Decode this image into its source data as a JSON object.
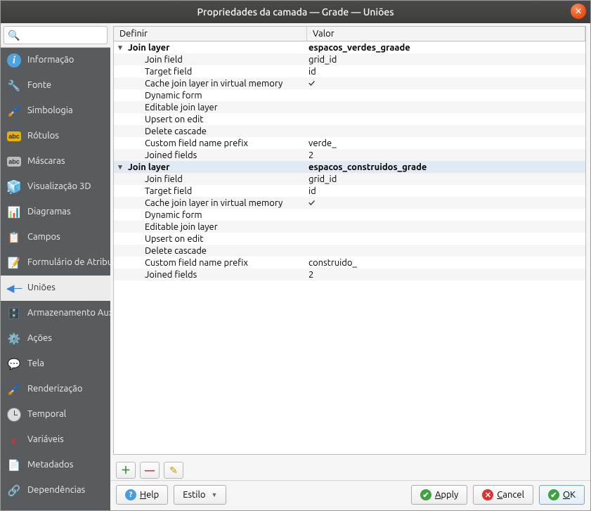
{
  "title": "Propriedades da camada — Grade — Uniões",
  "search_placeholder": "",
  "sidebar": {
    "items": [
      {
        "label": "Informação",
        "icon": "info"
      },
      {
        "label": "Fonte",
        "icon": "wrench"
      },
      {
        "label": "Simbologia",
        "icon": "brush"
      },
      {
        "label": "Rótulos",
        "icon": "abc"
      },
      {
        "label": "Máscaras",
        "icon": "abc-grey"
      },
      {
        "label": "Visualização 3D",
        "icon": "cube"
      },
      {
        "label": "Diagramas",
        "icon": "pie"
      },
      {
        "label": "Campos",
        "icon": "fields"
      },
      {
        "label": "Formulário de Atributos",
        "icon": "form"
      },
      {
        "label": "Uniões",
        "icon": "join",
        "active": true
      },
      {
        "label": "Armazenamento Auxiliar",
        "icon": "db"
      },
      {
        "label": "Ações",
        "icon": "gear"
      },
      {
        "label": "Tela",
        "icon": "tooltip"
      },
      {
        "label": "Renderização",
        "icon": "render"
      },
      {
        "label": "Temporal",
        "icon": "clock"
      },
      {
        "label": "Variáveis",
        "icon": "vars"
      },
      {
        "label": "Metadados",
        "icon": "meta"
      },
      {
        "label": "Dependências",
        "icon": "deps"
      }
    ]
  },
  "tree": {
    "headers": {
      "def": "Definir",
      "val": "Valor"
    },
    "groups": [
      {
        "label": "Join layer",
        "value": "espacos_verdes_graade",
        "selected": false,
        "rows": [
          {
            "def": "Join field",
            "val": "grid_id"
          },
          {
            "def": "Target field",
            "val": "id"
          },
          {
            "def": "Cache join layer in virtual memory",
            "val": "✓"
          },
          {
            "def": "Dynamic form",
            "val": ""
          },
          {
            "def": "Editable join layer",
            "val": ""
          },
          {
            "def": "Upsert on edit",
            "val": ""
          },
          {
            "def": "Delete cascade",
            "val": ""
          },
          {
            "def": "Custom field name prefix",
            "val": "verde_"
          },
          {
            "def": "Joined fields",
            "val": "2"
          }
        ]
      },
      {
        "label": "Join layer",
        "value": "espacos_construidos_grade",
        "selected": true,
        "rows": [
          {
            "def": "Join field",
            "val": "grid_id"
          },
          {
            "def": "Target field",
            "val": "id"
          },
          {
            "def": "Cache join layer in virtual memory",
            "val": "✓"
          },
          {
            "def": "Dynamic form",
            "val": ""
          },
          {
            "def": "Editable join layer",
            "val": ""
          },
          {
            "def": "Upsert on edit",
            "val": ""
          },
          {
            "def": "Delete cascade",
            "val": ""
          },
          {
            "def": "Custom field name prefix",
            "val": "construido_"
          },
          {
            "def": "Joined fields",
            "val": "2"
          }
        ]
      }
    ]
  },
  "bottom_toolbar": {
    "add": "＋",
    "remove": "—",
    "edit": "✎"
  },
  "footer": {
    "help": "Help",
    "style": "Estilo",
    "apply": "Apply",
    "cancel": "Cancel",
    "ok": "OK"
  }
}
